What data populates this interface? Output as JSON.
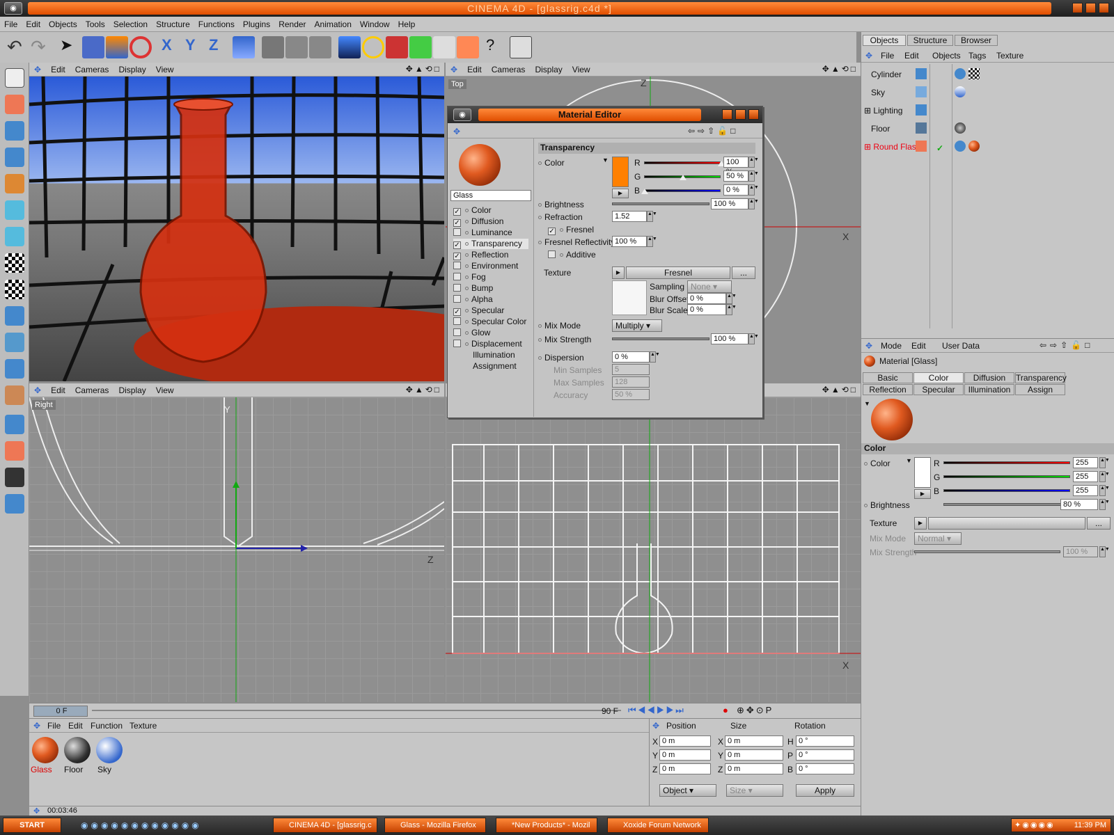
{
  "app": {
    "title": "CINEMA 4D - [glassrig.c4d *]"
  },
  "menubar": [
    "File",
    "Edit",
    "Objects",
    "Tools",
    "Selection",
    "Structure",
    "Functions",
    "Plugins",
    "Render",
    "Animation",
    "Window",
    "Help"
  ],
  "viewport_menu": [
    "Edit",
    "Cameras",
    "Display",
    "View"
  ],
  "viewports": {
    "top_label": "Top",
    "right_label": "Right",
    "axis_labels": {
      "z": "Z",
      "x": "X",
      "y": "Y"
    }
  },
  "material_editor": {
    "title": "Material Editor",
    "material_name": "Glass",
    "channels": [
      {
        "label": "Color",
        "checked": true
      },
      {
        "label": "Diffusion",
        "checked": true
      },
      {
        "label": "Luminance",
        "checked": false
      },
      {
        "label": "Transparency",
        "checked": true
      },
      {
        "label": "Reflection",
        "checked": true
      },
      {
        "label": "Environment",
        "checked": false
      },
      {
        "label": "Fog",
        "checked": false
      },
      {
        "label": "Bump",
        "checked": false
      },
      {
        "label": "Alpha",
        "checked": false
      },
      {
        "label": "Specular",
        "checked": true
      },
      {
        "label": "Specular Color",
        "checked": false
      },
      {
        "label": "Glow",
        "checked": false
      },
      {
        "label": "Displacement",
        "checked": false
      },
      {
        "label": "Illumination",
        "checked": null
      },
      {
        "label": "Assignment",
        "checked": null
      }
    ],
    "section": "Transparency",
    "color_label": "Color",
    "r_label": "R",
    "g_label": "G",
    "b_label": "B",
    "r": "100 %",
    "g": "50 %",
    "b": "0 %",
    "r_level": 1.0,
    "g_level": 0.5,
    "b_level": 0.0,
    "brightness_label": "Brightness",
    "brightness": "100 %",
    "refraction_label": "Refraction",
    "refraction": "1.52",
    "fresnel_label": "Fresnel",
    "fresnel_reflectivity_label": "Fresnel Reflectivity",
    "fresnel_reflectivity": "100 %",
    "additive_label": "Additive",
    "texture_label": "Texture",
    "texture_button": "Fresnel",
    "more_button": "...",
    "sampling_label": "Sampling",
    "sampling": "None",
    "blur_offset_label": "Blur Offset",
    "blur_offset": "0 %",
    "blur_scale_label": "Blur Scale",
    "blur_scale": "0 %",
    "mix_mode_label": "Mix Mode",
    "mix_mode": "Multiply",
    "mix_strength_label": "Mix Strength",
    "mix_strength": "100 %",
    "dispersion_label": "Dispersion",
    "dispersion": "0 %",
    "min_samples_label": "Min Samples",
    "min_samples": "5",
    "max_samples_label": "Max Samples",
    "max_samples": "128",
    "accuracy_label": "Accuracy",
    "accuracy": "50 %",
    "swatch_color": "#ff8000"
  },
  "object_manager": {
    "tabs": [
      "Objects",
      "Structure",
      "Browser"
    ],
    "menu": [
      "File",
      "Edit",
      "Objects",
      "Tags",
      "Texture"
    ],
    "objects": [
      "Cylinder",
      "Sky",
      "Lighting",
      "Floor",
      "Round Flask"
    ]
  },
  "attributes": {
    "menu": [
      "Mode",
      "Edit",
      "User Data"
    ],
    "title": "Material [Glass]",
    "tabs": [
      "Basic",
      "Color",
      "Diffusion",
      "Transparency",
      "Reflection",
      "Specular",
      "Illumination",
      "Assign"
    ],
    "section": "Color",
    "color_label": "Color",
    "r_label": "R",
    "g_label": "G",
    "b_label": "B",
    "r": "255",
    "g": "255",
    "b": "255",
    "brightness_label": "Brightness",
    "brightness": "80 %",
    "texture_label": "Texture",
    "more_button": "...",
    "mix_mode_label": "Mix Mode",
    "mix_mode": "Normal",
    "mix_strength_label": "Mix Strength",
    "mix_strength": "100 %"
  },
  "timeline": {
    "current": "0 F",
    "end": "90 F"
  },
  "material_manager": {
    "menu": [
      "File",
      "Edit",
      "Function",
      "Texture"
    ],
    "materials": [
      "Glass",
      "Floor",
      "Sky"
    ]
  },
  "coordinates": {
    "headers": [
      "Position",
      "Size",
      "Rotation"
    ],
    "pos": {
      "x": "0 m",
      "y": "0 m",
      "z": "0 m"
    },
    "size": {
      "x": "0 m",
      "y": "0 m",
      "z": "0 m"
    },
    "rot": {
      "h": "0 °",
      "p": "0 °",
      "b": "0 °"
    },
    "labels": {
      "x": "X",
      "y": "Y",
      "z": "Z",
      "h": "H",
      "p": "P",
      "b": "B"
    },
    "mode": "Object",
    "size_mode": "Size",
    "apply": "Apply"
  },
  "status": {
    "time": "00:03:46"
  },
  "taskbar": {
    "start": "START",
    "buttons": [
      "CINEMA 4D - [glassrig.c",
      "Glass - Mozilla Firefox",
      "*New Products* - Mozil",
      "Xoxide Forum Network"
    ],
    "clock": "11:39 PM"
  },
  "colors": {
    "accent": "#ff6a14",
    "panel": "#c6c6c6",
    "viewport": "#8f8f8f"
  }
}
